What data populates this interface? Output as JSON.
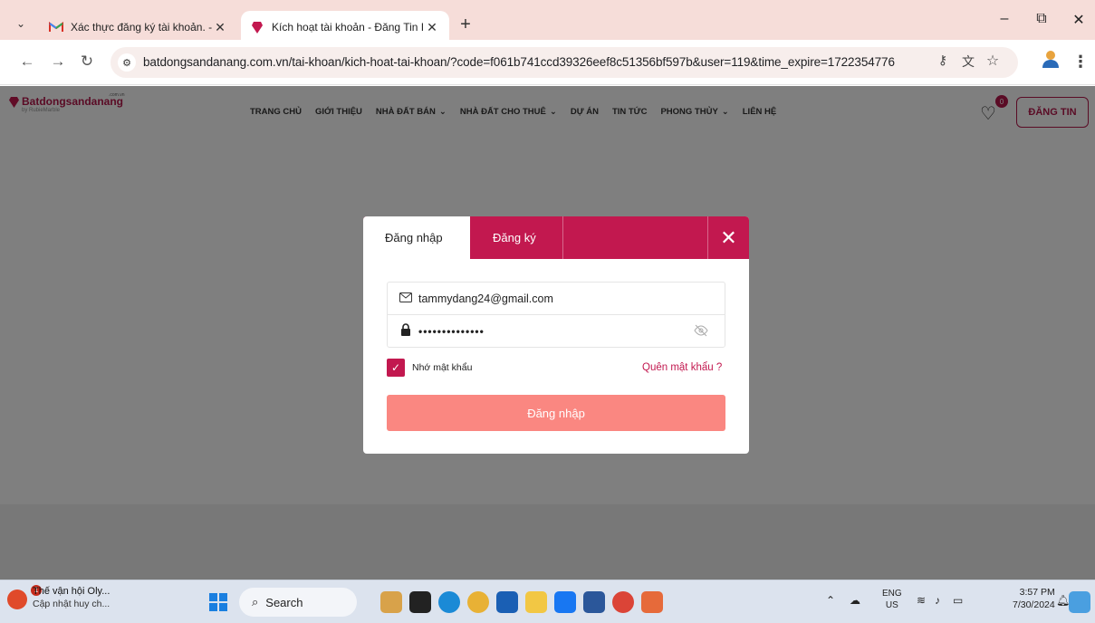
{
  "browser": {
    "tabs": [
      {
        "title": "Xác thực đăng ký tài khoản. - ta",
        "active": false
      },
      {
        "title": "Kích hoạt tài khoản - Đăng Tin I",
        "active": true
      }
    ],
    "url": "batdongsandanang.com.vn/tai-khoan/kich-hoat-tai-khoan/?code=f061b741ccd39326eef8c51356bf597b&user=119&time_expire=1722354776",
    "new_tab": "+",
    "minimize": "–",
    "restore": "⧉",
    "close": "✕"
  },
  "site": {
    "logo": "Batdongsandanang",
    "logo_sub": "by RubieMarble",
    "logo_domain": ".com.vn",
    "nav": [
      {
        "label": "TRANG CHỦ",
        "dropdown": false
      },
      {
        "label": "GIỚI THIỆU",
        "dropdown": false
      },
      {
        "label": "NHÀ ĐẤT BÁN",
        "dropdown": true
      },
      {
        "label": "NHÀ ĐẤT CHO THUÊ",
        "dropdown": true
      },
      {
        "label": "DỰ ÁN",
        "dropdown": false
      },
      {
        "label": "TIN TỨC",
        "dropdown": false
      },
      {
        "label": "PHONG THỦY",
        "dropdown": true
      },
      {
        "label": "LIÊN HỆ",
        "dropdown": false
      }
    ],
    "favorites_count": "0",
    "post_button": "ĐĂNG TIN"
  },
  "modal": {
    "tab_login": "Đăng nhập",
    "tab_register": "Đăng ký",
    "close": "✕",
    "email_value": "tammydang24@gmail.com",
    "password_masked": "••••••••••••••",
    "remember_label": "Nhớ mật khẩu",
    "remember_checked": true,
    "forgot_link": "Quên mật khẩu ?",
    "submit_label": "Đăng nhập",
    "colors": {
      "primary": "#c2184f",
      "submit": "#fa8781"
    }
  },
  "taskbar": {
    "news_title": "Thế vận hội Oly...",
    "news_sub": "Cập nhật huy ch...",
    "news_badge": "1",
    "search_label": "Search",
    "lang_top": "ENG",
    "lang_bottom": "US",
    "time": "3:57 PM",
    "date": "7/30/2024"
  }
}
